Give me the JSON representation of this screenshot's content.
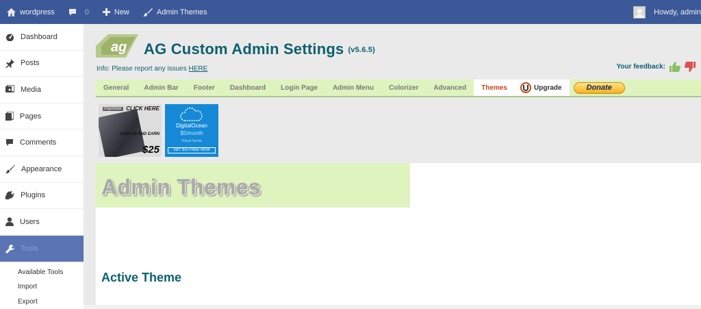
{
  "adminbar": {
    "site_name": "wordpress",
    "comments_count": "0",
    "new_label": "New",
    "plugin_link": "Admin Themes",
    "howdy": "Howdy, admin"
  },
  "sidebar": {
    "items": [
      {
        "label": "Dashboard",
        "icon": "dashboard-icon"
      },
      {
        "label": "Posts",
        "icon": "pushpin-icon"
      },
      {
        "label": "Media",
        "icon": "media-icon"
      },
      {
        "label": "Pages",
        "icon": "pages-icon"
      },
      {
        "label": "Comments",
        "icon": "comment-icon"
      },
      {
        "label": "Appearance",
        "icon": "brush-icon"
      },
      {
        "label": "Plugins",
        "icon": "plug-icon"
      },
      {
        "label": "Users",
        "icon": "user-icon"
      },
      {
        "label": "Tools",
        "icon": "wrench-icon",
        "active": true
      }
    ],
    "submenu": [
      "Available Tools",
      "Import",
      "Export"
    ]
  },
  "header": {
    "logo_text": "ag",
    "title": "AG Custom Admin Settings",
    "version": "(v5.6.5)",
    "info_prefix": "Info: Please report any issues",
    "info_link": "HERE",
    "feedback_label": "Your feedback:"
  },
  "tabs": [
    "General",
    "Admin Bar",
    "Footer",
    "Dashboard",
    "Login Page",
    "Admin Menu",
    "Colorizer",
    "Advanced",
    "Themes"
  ],
  "active_tab": "Themes",
  "upgrade_label": "Upgrade",
  "donate_label": "Donate",
  "ads": {
    "payoneer": {
      "brand": "Payoneer",
      "click": "CLICK HERE",
      "signup": "SIGN UP AND EARN",
      "price": "$25"
    },
    "digitalocean": {
      "name": "DigitalOcean",
      "price": "$5/month",
      "subtitle": "Virtual Server",
      "cta": "GET $10 FREE NOW"
    }
  },
  "page": {
    "heading": "Admin Themes",
    "section": "Active Theme"
  },
  "colors": {
    "adminbar": "#3b5998",
    "accent": "#0d5f6e",
    "tab_bar": "#dff3bf",
    "active_tab_text": "#c7481b",
    "menu_active": "#5b74b3"
  }
}
